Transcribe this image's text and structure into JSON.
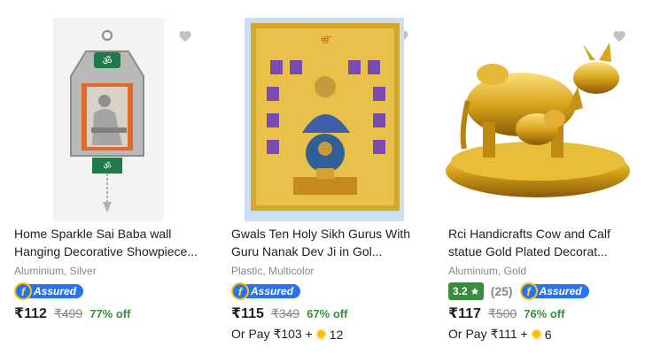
{
  "products": [
    {
      "title_line1": "Home Sparkle Sai Baba wall",
      "title_line2": "Hanging Decorative Showpiece...",
      "attributes": "Aluminium, Silver",
      "assured": "Assured",
      "price": "₹112",
      "mrp": "₹499",
      "discount": "77% off"
    },
    {
      "title_line1": "Gwals Ten Holy Sikh Gurus With",
      "title_line2": "Guru Nanak Dev Ji in Gol...",
      "attributes": "Plastic, Multicolor",
      "assured": "Assured",
      "price": "₹115",
      "mrp": "₹349",
      "discount": "67% off",
      "or_pay_label": "Or Pay ₹103 +",
      "coins": "12"
    },
    {
      "title_line1": "Rci Handicrafts Cow and Calf",
      "title_line2": "statue Gold Plated Decorat...",
      "attributes": "Aluminium, Gold",
      "rating": "3.2",
      "rating_count": "(25)",
      "assured": "Assured",
      "price": "₹117",
      "mrp": "₹500",
      "discount": "76% off",
      "or_pay_label": "Or Pay ₹111 +",
      "coins": "6"
    }
  ],
  "colors": {
    "discount_green": "#388e3c",
    "assured_blue": "#2874f0",
    "wishlist_grey": "#c2c2c2",
    "coin_gold": "#ffb800"
  },
  "icons": {
    "wishlist": "heart-icon",
    "rating": "star-icon",
    "coin": "supercoin-icon",
    "assured": "flipkart-assured-icon"
  }
}
